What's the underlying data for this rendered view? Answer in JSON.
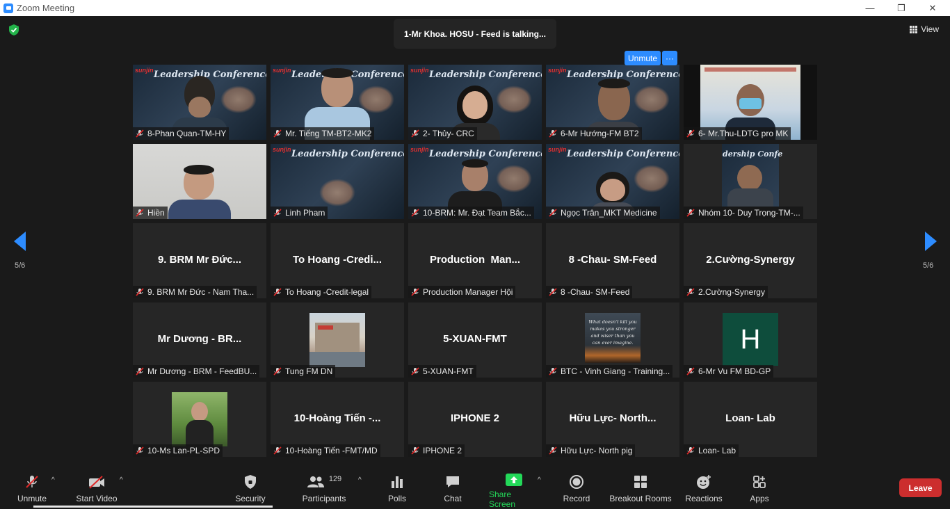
{
  "window": {
    "title": "Zoom Meeting"
  },
  "meeting": {
    "active_speaker": "1-Mr Khoa. HOSU - Feed is talking...",
    "view_label": "View",
    "page_indicator": "5/6",
    "unmute_label": "Unmute",
    "more_label": "···"
  },
  "tiles": [
    {
      "name": "8-Phan Quan-TM-HY"
    },
    {
      "name": "Mr. Tiếng TM-BT2-MK2"
    },
    {
      "name": "2- Thủy- CRC"
    },
    {
      "name": "6-Mr Hướng-FM BT2"
    },
    {
      "name": "6- Mr.Thu-LDTG pro MK"
    },
    {
      "name": "Hiền"
    },
    {
      "name": "Linh Pham"
    },
    {
      "name": "10-BRM: Mr. Đạt Team Bắc..."
    },
    {
      "name": "Ngọc Trân_MKT Medicine"
    },
    {
      "name": "Nhóm 10- Duy Trọng-TM-..."
    },
    {
      "display": "9. BRM Mr Đức...",
      "name": "9. BRM Mr Đức - Nam Tha..."
    },
    {
      "display": "To Hoang -Credi...",
      "name": "To Hoang -Credit-legal"
    },
    {
      "display": "Production  Man...",
      "name": "Production Manager Hội"
    },
    {
      "display": "8 -Chau- SM-Feed",
      "name": "8 -Chau- SM-Feed"
    },
    {
      "display": "2.Cường-Synergy",
      "name": "2.Cường-Synergy"
    },
    {
      "display": "Mr Dương - BR...",
      "name": "Mr Dương - BRM - FeedBU..."
    },
    {
      "name": "Tung FM DN"
    },
    {
      "display": "5-XUAN-FMT",
      "name": "5-XUAN-FMT"
    },
    {
      "name": "BTC - Vinh Giang - Training...",
      "quote": "What doesn't kill you makes you stronger and wiser than you can ever imagine."
    },
    {
      "name": "6-Mr Vu FM BD-GP",
      "avatar_letter": "H"
    },
    {
      "name": "10-Ms Lan-PL-SPD"
    },
    {
      "display": "10-Hoàng Tiến -...",
      "name": "10-Hoàng Tiến -FMT/MD"
    },
    {
      "display": "IPHONE 2",
      "name": "IPHONE 2"
    },
    {
      "display": "Hữu Lực- North...",
      "name": "Hữu Lực- North pig"
    },
    {
      "display": "Loan- Lab",
      "name": "Loan- Lab"
    }
  ],
  "poster": {
    "logo": "sunjin",
    "brand": "Leadership Conference"
  },
  "toolbar": {
    "unmute": "Unmute",
    "start_video": "Start Video",
    "security": "Security",
    "participants": "Participants",
    "participants_count": "129",
    "polls": "Polls",
    "chat": "Chat",
    "share_screen": "Share Screen",
    "record": "Record",
    "breakout_rooms": "Breakout Rooms",
    "reactions": "Reactions",
    "apps": "Apps",
    "leave": "Leave"
  },
  "colors": {
    "accent": "#2d8cff",
    "share": "#23d959",
    "leave": "#cc2e2e",
    "muted": "#e02828",
    "avatar": "#0e4d3c"
  }
}
